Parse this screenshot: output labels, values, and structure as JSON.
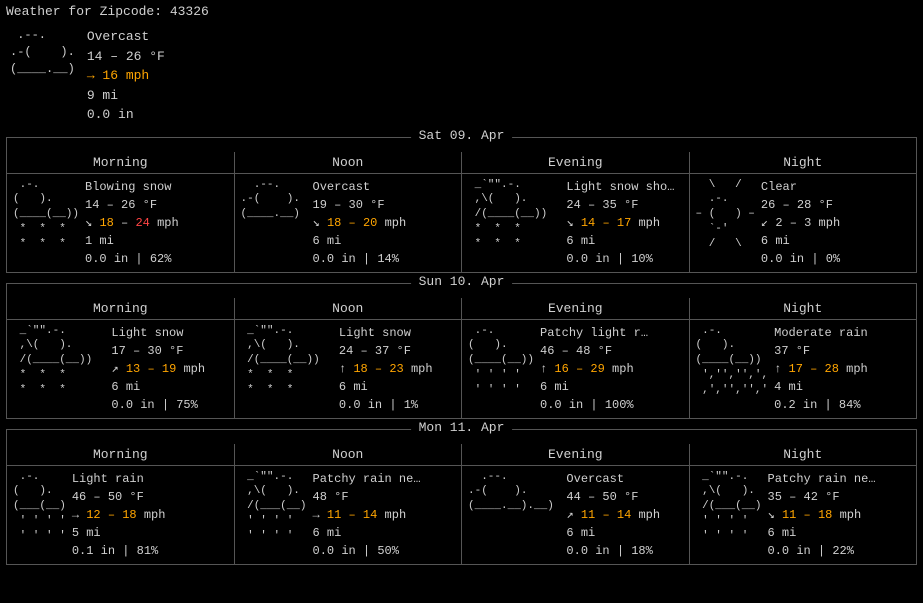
{
  "title": "Weather for Zipcode: 43326",
  "current": {
    "icon": " .-.\n.-(    ).\n(____.__)__)",
    "condition": "Overcast",
    "temp": "14 – 26 °F",
    "wind": "→ 16 mph",
    "visibility": "9 mi",
    "precip": "0.0 in"
  },
  "days": [
    {
      "label": "Sat 09. Apr",
      "periods": [
        {
          "name": "Morning",
          "icon": " .-.\n(   ).\n(____(__))\n *  *  *\n *  *  *",
          "condition": "Blowing snow",
          "temp": "14 – 26 °F",
          "wind": "↘ 18 – 24 mph",
          "windColor": "orange-red",
          "visibility": "1 mi",
          "precip": "0.0 in | 62%"
        },
        {
          "name": "Noon",
          "icon": "  .-.\n.-( ).\n(____.__)__)",
          "condition": "Overcast",
          "temp": "19 – 30 °F",
          "wind": "↘ 18 – 20 mph",
          "windColor": "orange",
          "visibility": "6 mi",
          "precip": "0.0 in | 14%"
        },
        {
          "name": "Evening",
          "icon": " _`\"\".-.\n ,\\( ).\n /(____(__))\n *  *  *\n *  *  *",
          "condition": "Light snow sho…",
          "temp": "24 – 35 °F",
          "wind": "↘ 14 – 17 mph",
          "windColor": "orange",
          "visibility": "6 mi",
          "precip": "0.0 in | 10%"
        },
        {
          "name": "Night",
          "icon": "  \\   /\n .-.\n– (  ) –\n `-'\n /   \\",
          "condition": "Clear",
          "temp": "26 – 28 °F",
          "wind": "↙ 2 – 3 mph",
          "windColor": "normal",
          "visibility": "6 mi",
          "precip": "0.0 in | 0%"
        }
      ]
    },
    {
      "label": "Sun 10. Apr",
      "periods": [
        {
          "name": "Morning",
          "icon": " _`\"\".-.\n ,\\( ).\n /(____(__))\n *  *  *\n *  *  *",
          "condition": "Light snow",
          "temp": "17 – 30 °F",
          "wind": "↗ 13 – 19 mph",
          "windColor": "orange",
          "visibility": "6 mi",
          "precip": "0.0 in | 75%"
        },
        {
          "name": "Noon",
          "icon": " _`\"\".-.\n ,\\( ).\n /(____(__))\n *  *  *\n *  *  *",
          "condition": "Light snow",
          "temp": "24 – 37 °F",
          "wind": "↑ 18 – 23 mph",
          "windColor": "orange",
          "visibility": "6 mi",
          "precip": "0.0 in | 1%"
        },
        {
          "name": "Evening",
          "icon": " .-.\n(   ).\n(____(__))\n ' ' ' '\n ' ' ' '",
          "condition": "Patchy light r…",
          "temp": "46 – 48 °F",
          "wind": "↑ 16 – 29 mph",
          "windColor": "orange",
          "visibility": "6 mi",
          "precip": "0.0 in | 100%"
        },
        {
          "name": "Night",
          "icon": " .-.\n(   ).\n(____(__))\n ','','',',\n ,','','','",
          "condition": "Moderate rain",
          "temp": "37 °F",
          "wind": "↑ 17 – 28 mph",
          "windColor": "orange",
          "visibility": "4 mi",
          "precip": "0.2 in | 84%"
        }
      ]
    },
    {
      "label": "Mon 11. Apr",
      "periods": [
        {
          "name": "Morning",
          "icon": " .-.\n(   ).\n(___(__)\n ' ' ' '\n ' ' ' '",
          "condition": "Light rain",
          "temp": "46 – 50 °F",
          "wind": "→ 12 – 18 mph",
          "windColor": "orange",
          "visibility": "5 mi",
          "precip": "0.1 in | 81%"
        },
        {
          "name": "Noon",
          "icon": " _`\"\".-.\n ,\\( ).\n /(___(__)\n ' ' ' '\n ' ' ' '",
          "condition": "Patchy rain ne…",
          "temp": "48 °F",
          "wind": "→ 11 – 14 mph",
          "windColor": "orange",
          "visibility": "6 mi",
          "precip": "0.0 in | 50%"
        },
        {
          "name": "Evening",
          "icon": "  .-.\n.-( ).\n(____.__).__)\n",
          "condition": "Overcast",
          "temp": "44 – 50 °F",
          "wind": "↗ 11 – 14 mph",
          "windColor": "orange",
          "visibility": "6 mi",
          "precip": "0.0 in | 18%"
        },
        {
          "name": "Night",
          "icon": " _`\"\".-.\n ,\\( ).\n /(___(__)\n ' ' ' '\n ' ' ' '",
          "condition": "Patchy rain ne…",
          "temp": "35 – 42 °F",
          "wind": "↘ 11 – 18 mph",
          "windColor": "orange",
          "visibility": "6 mi",
          "precip": "0.0 in | 22%"
        }
      ]
    }
  ]
}
